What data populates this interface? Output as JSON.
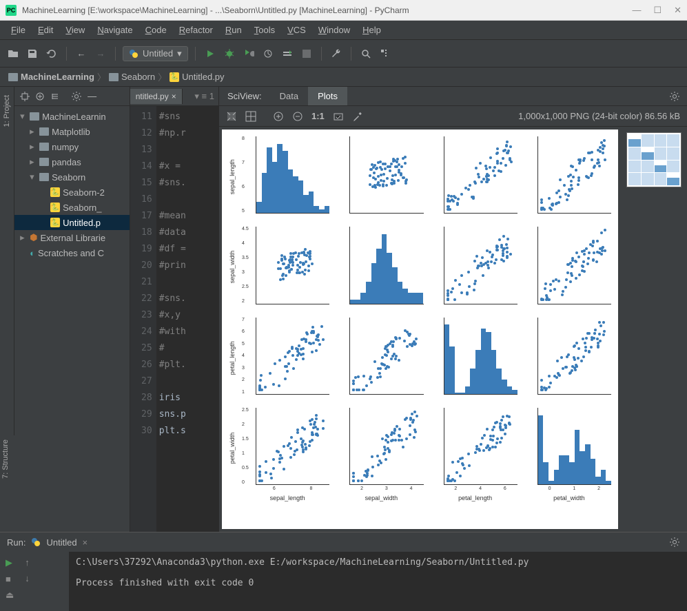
{
  "window": {
    "app_badge": "PC",
    "title": "MachineLearning [E:\\workspace\\MachineLearning] - ...\\Seaborn\\Untitled.py [MachineLearning] - PyCharm"
  },
  "menu": [
    "File",
    "Edit",
    "View",
    "Navigate",
    "Code",
    "Refactor",
    "Run",
    "Tools",
    "VCS",
    "Window",
    "Help"
  ],
  "toolbar": {
    "run_config": "Untitled"
  },
  "breadcrumbs": [
    {
      "icon": "folder",
      "label": "MachineLearning"
    },
    {
      "icon": "folder",
      "label": "Seaborn"
    },
    {
      "icon": "python",
      "label": "Untitled.py"
    }
  ],
  "left_tabs": {
    "project": "1: Project",
    "structure": "7: Structure"
  },
  "project_tree": {
    "root": "MachineLearnin",
    "children": [
      {
        "label": "Matplotlib",
        "icon": "folder",
        "expandable": true
      },
      {
        "label": "numpy",
        "icon": "folder",
        "expandable": true
      },
      {
        "label": "pandas",
        "icon": "folder",
        "expandable": true
      },
      {
        "label": "Seaborn",
        "icon": "folder",
        "expanded": true,
        "children": [
          {
            "label": "Seaborn-2",
            "icon": "python"
          },
          {
            "label": "Seaborn_",
            "icon": "python"
          },
          {
            "label": "Untitled.p",
            "icon": "python",
            "selected": true
          }
        ]
      }
    ],
    "external": "External Librarie",
    "scratches": "Scratches and C"
  },
  "editor": {
    "tab": "ntitled.py",
    "first_line_no": 11,
    "lines": [
      {
        "n": 11,
        "t": "#sns",
        "cls": "com"
      },
      {
        "n": 12,
        "t": "#np.r",
        "cls": "com"
      },
      {
        "n": 13,
        "t": "",
        "cls": ""
      },
      {
        "n": 14,
        "t": "#x =",
        "cls": "com"
      },
      {
        "n": 15,
        "t": "#sns.",
        "cls": "com"
      },
      {
        "n": 16,
        "t": "",
        "cls": ""
      },
      {
        "n": 17,
        "t": "#mean",
        "cls": "com"
      },
      {
        "n": 18,
        "t": "#data",
        "cls": "com"
      },
      {
        "n": 19,
        "t": "#df =",
        "cls": "com"
      },
      {
        "n": 20,
        "t": "#prin",
        "cls": "com"
      },
      {
        "n": 21,
        "t": "",
        "cls": ""
      },
      {
        "n": 22,
        "t": "#sns.",
        "cls": "com"
      },
      {
        "n": 23,
        "t": "#x,y",
        "cls": "com"
      },
      {
        "n": 24,
        "t": "#with",
        "cls": "com"
      },
      {
        "n": 25,
        "t": "#",
        "cls": "com"
      },
      {
        "n": 26,
        "t": "#plt.",
        "cls": "com"
      },
      {
        "n": 27,
        "t": "",
        "cls": ""
      },
      {
        "n": 28,
        "t": "iris",
        "cls": "id"
      },
      {
        "n": 29,
        "t": "sns.p",
        "cls": "id"
      },
      {
        "n": 30,
        "t": "plt.s",
        "cls": "id"
      }
    ]
  },
  "sciview": {
    "label": "SciView:",
    "tabs": [
      "Data",
      "Plots"
    ],
    "active_tab": "Plots",
    "zoom_label": "1:1",
    "info": "1,000x1,000 PNG (24-bit color) 86.56 kB"
  },
  "chart_data": {
    "type": "pairplot",
    "variables": [
      "sepal_length",
      "sepal_width",
      "petal_length",
      "petal_width"
    ],
    "row_labels": [
      "sepal_length",
      "sepal_width",
      "petal_length",
      "petal_width"
    ],
    "col_labels": [
      "sepal_length",
      "sepal_width",
      "petal_length",
      "petal_width"
    ],
    "diagonal": "hist",
    "color": "#3b7cb8",
    "axes_ranges": {
      "sepal_length": [
        4,
        8
      ],
      "sepal_width": [
        2,
        4.5
      ],
      "petal_length": [
        1,
        7
      ],
      "petal_width": [
        0,
        2.5
      ]
    },
    "y_ticks": {
      "sepal_length": [
        5,
        6,
        7,
        8
      ],
      "sepal_width": [
        2.0,
        2.5,
        3.0,
        3.5,
        4.0,
        4.5
      ],
      "petal_length": [
        1,
        2,
        3,
        4,
        5,
        6,
        7
      ],
      "petal_width": [
        0.0,
        0.5,
        1.0,
        1.5,
        2.0,
        2.5
      ]
    },
    "x_ticks": {
      "sepal_length": [
        6,
        8
      ],
      "sepal_width": [
        2,
        3,
        4
      ],
      "petal_length": [
        2,
        4,
        6
      ],
      "petal_width": [
        0,
        1,
        2
      ]
    },
    "hist_shapes": {
      "sepal_length": [
        0.15,
        0.55,
        0.9,
        0.7,
        0.95,
        0.85,
        0.6,
        0.5,
        0.45,
        0.25,
        0.3,
        0.1,
        0.05,
        0.1
      ],
      "sepal_width": [
        0.05,
        0.05,
        0.15,
        0.3,
        0.55,
        0.75,
        0.95,
        0.7,
        0.5,
        0.3,
        0.2,
        0.15,
        0.15,
        0.15
      ],
      "petal_length": [
        0.95,
        0.65,
        0.02,
        0.02,
        0.1,
        0.35,
        0.6,
        0.9,
        0.85,
        0.6,
        0.35,
        0.2,
        0.1,
        0.05
      ],
      "petal_width": [
        0.95,
        0.3,
        0.05,
        0.2,
        0.4,
        0.4,
        0.3,
        0.75,
        0.45,
        0.55,
        0.35,
        0.1,
        0.2,
        0.05
      ]
    },
    "scatter_clusters": {
      "sepal_length_vs_petal_length": "positive_two_clusters",
      "sepal_length_vs_petal_width": "positive_two_clusters",
      "sepal_width_vs_petal_length": "weak_two_clusters",
      "sepal_width_vs_petal_width": "weak_two_clusters",
      "petal_length_vs_petal_width": "strong_positive_two_clusters",
      "sepal_length_vs_sepal_width": "diffuse"
    }
  },
  "run": {
    "label": "Run:",
    "config": "Untitled",
    "console": [
      "C:\\Users\\37292\\Anaconda3\\python.exe  E:/workspace/MachineLearning/Seaborn/Untitled.py",
      "",
      "Process finished with exit code 0"
    ]
  }
}
